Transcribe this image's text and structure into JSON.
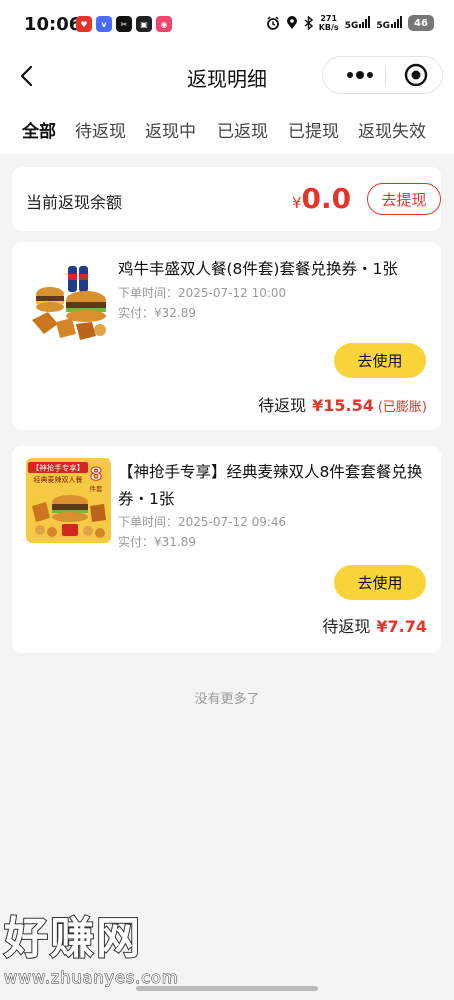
{
  "status_bar": {
    "time": "10:06",
    "app_icons": [
      {
        "name": "red-app-icon",
        "color": "#e5352b"
      },
      {
        "name": "vivo-app-icon",
        "color": "#4a6cf7"
      },
      {
        "name": "scissors-app-icon",
        "color": "#111111"
      },
      {
        "name": "photo-app-icon",
        "color": "#222222"
      },
      {
        "name": "pink-app-icon",
        "color": "#f0436b"
      }
    ],
    "net_speed_value": "271",
    "net_speed_unit": "KB/s",
    "signal_1": "5G",
    "signal_2": "5G",
    "battery": "46"
  },
  "nav": {
    "title": "返现明细"
  },
  "tabs": [
    {
      "label": "全部",
      "active": true
    },
    {
      "label": "待返现",
      "active": false
    },
    {
      "label": "返现中",
      "active": false
    },
    {
      "label": "已返现",
      "active": false
    },
    {
      "label": "已提现",
      "active": false
    },
    {
      "label": "返现失效",
      "active": false
    }
  ],
  "balance": {
    "label": "当前返现余额",
    "currency": "¥",
    "amount": "0.0",
    "withdraw_label": "去提现"
  },
  "orders": [
    {
      "title": "鸡牛丰盛双人餐(8件套)套餐兑换券・1张",
      "order_time_label": "下单时间：",
      "order_time": "2025-07-12 10:00",
      "paid_label": "实付：",
      "paid": "¥32.89",
      "use_label": "去使用",
      "pending_label": "待返现",
      "pending_amount": "¥15.54",
      "pending_note": "(已膨胀)"
    },
    {
      "title": "【神抢手专享】经典麦辣双人8件套套餐兑换券・1张",
      "order_time_label": "下单时间：",
      "order_time": "2025-07-12 09:46",
      "paid_label": "实付：",
      "paid": "¥31.89",
      "use_label": "去使用",
      "pending_label": "待返现",
      "pending_amount": "¥7.74",
      "pending_note": "",
      "thumb_badge": "【神抢手专享】",
      "thumb_subtitle": "经典麦辣双人餐",
      "thumb_number": "8",
      "thumb_unit": "件套"
    }
  ],
  "footer": {
    "no_more": "没有更多了"
  },
  "watermark": {
    "brand": "好赚网",
    "url": "www.zhuanyes.com"
  },
  "colors": {
    "accent_red": "#e5352b",
    "button_yellow": "#f8d438",
    "page_bg": "#f4f4f4"
  }
}
